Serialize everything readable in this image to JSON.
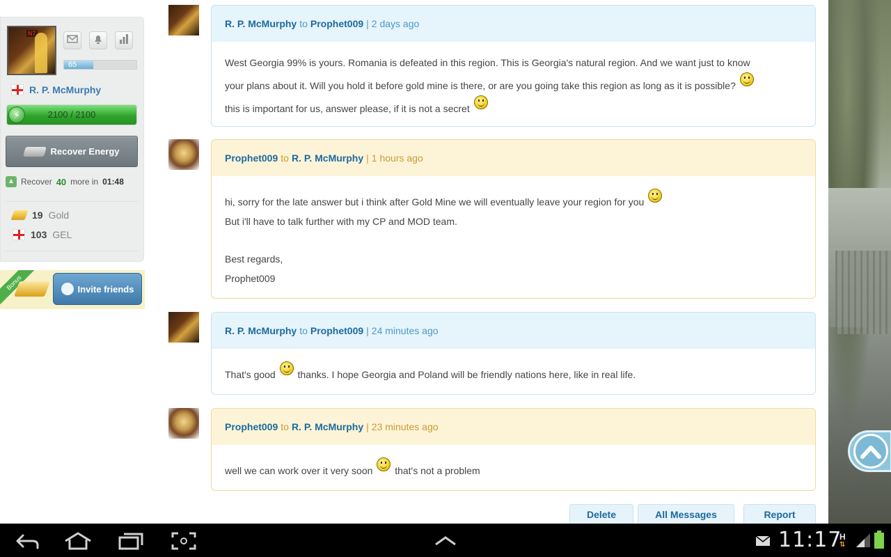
{
  "sidebar": {
    "level": "65",
    "level_progress": 0.4,
    "username": "R. P. McMurphy",
    "energy": "2100 / 2100",
    "energy_progress": 1.0,
    "recover_button": "Recover Energy",
    "recover_prefix": "Recover",
    "recover_amount": "40",
    "recover_mid": "more in",
    "recover_time": "01:48",
    "resources": [
      {
        "amount": "19",
        "unit": "Gold"
      },
      {
        "amount": "103",
        "unit": "GEL"
      }
    ],
    "bonus_ribbon": "Bonus",
    "invite_button": "Invite friends"
  },
  "messages": [
    {
      "from": "R. P. McMurphy",
      "to_word": "to",
      "to": "Prophet009",
      "time": "2 days ago",
      "lines": [
        "West Georgia 99% is yours. Romania is defeated in this region. This is Georgia's natural region. And we want just to know",
        "your plans about it. Will you hold it before gold mine is there, or are you going take this region as long as it is possible?",
        "this is important for us, answer please, if it is not a secret"
      ]
    },
    {
      "from": "Prophet009",
      "to_word": "to",
      "to": "R. P. McMurphy",
      "time": "1 hours ago",
      "lines": [
        "hi, sorry for the late answer but i think after Gold Mine we will eventually leave your region for you",
        "But i'll have to talk further with my CP and MOD team.",
        "",
        "Best regards,",
        "Prophet009"
      ]
    },
    {
      "from": "R. P. McMurphy",
      "to_word": "to",
      "to": "Prophet009",
      "time": "24 minutes ago",
      "text_a": "That's good",
      "text_b": "thanks. I hope Georgia and Poland will be friendly nations here, like in real life."
    },
    {
      "from": "Prophet009",
      "to_word": "to",
      "to": "R. P. McMurphy",
      "time": "23 minutes ago",
      "text_a": "well we can work over it very soon",
      "text_b": "that's not a problem"
    }
  ],
  "actions": {
    "delete": "Delete",
    "all_messages": "All Messages",
    "report": "Report"
  },
  "statusbar": {
    "time": "11:17",
    "network": "H"
  }
}
